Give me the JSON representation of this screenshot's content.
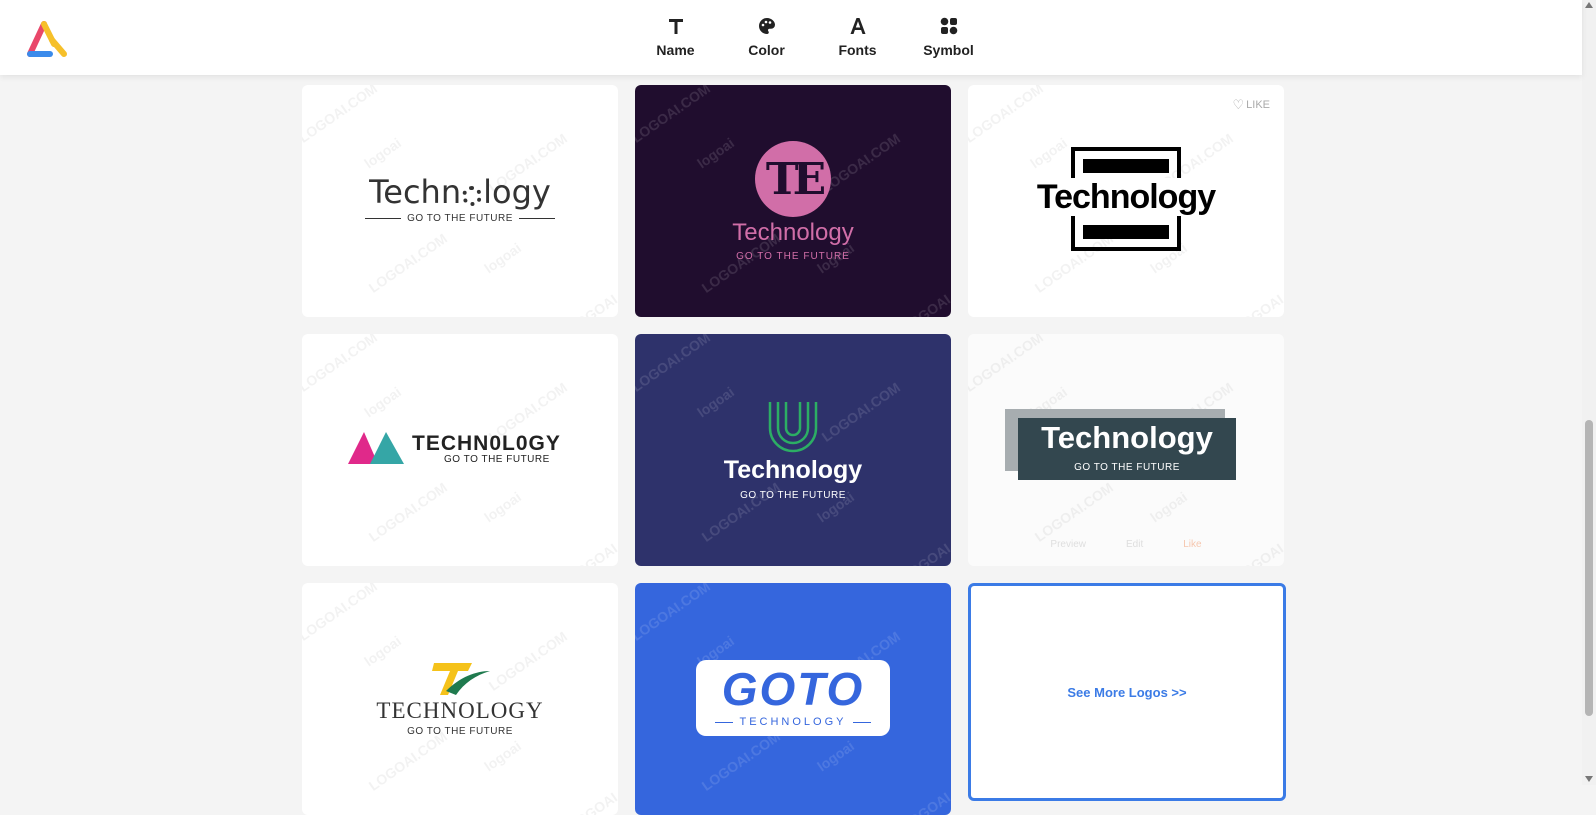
{
  "nav": [
    {
      "label": "Name",
      "icon": "text-t-icon"
    },
    {
      "label": "Color",
      "icon": "palette-icon"
    },
    {
      "label": "Fonts",
      "icon": "letter-a-icon"
    },
    {
      "label": "Symbol",
      "icon": "shapes-icon"
    }
  ],
  "watermark": {
    "site": "LOGOAI.COM",
    "brand": "logoai"
  },
  "cards": {
    "c1": {
      "name": "Techn",
      "name2": "logy",
      "tagline": "GO TO THE FUTURE"
    },
    "c2": {
      "monogram": "TE",
      "name": "Technology",
      "tagline": "GO TO THE FUTURE"
    },
    "c3": {
      "name": "Technology",
      "like": "LIKE"
    },
    "c4": {
      "name": "TECHN0L0GY",
      "tagline": "GO TO THE FUTURE"
    },
    "c5": {
      "name": "Technology",
      "tagline": "GO TO THE FUTURE"
    },
    "c6": {
      "name": "Technology",
      "tagline": "GO TO THE FUTURE",
      "actions": [
        "Preview",
        "Edit",
        "Like"
      ]
    },
    "c7": {
      "name": "TECHNOLOGY",
      "tagline": "GO TO THE FUTURE"
    },
    "c8": {
      "name": "GOTO",
      "tagline": "TECHNOLOGY"
    }
  },
  "see_more": "See More Logos >>",
  "colors": {
    "accent": "#3b7be6",
    "card_dark": "#200d2e",
    "card_navy": "#2e326b",
    "card_blue": "#3566dd",
    "pink": "#d16ea8",
    "green": "#2cae64"
  }
}
